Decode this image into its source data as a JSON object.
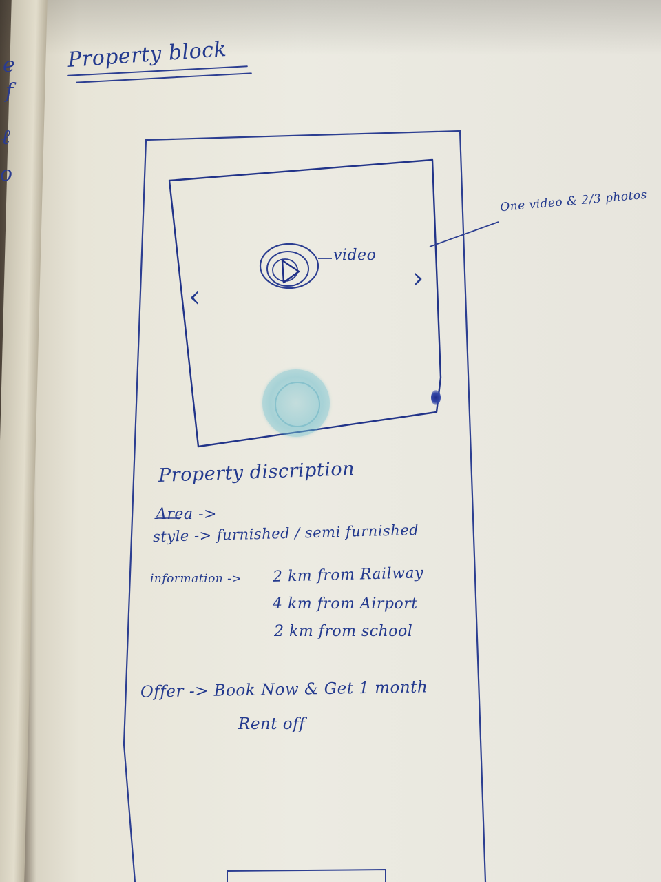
{
  "heading": "Property block",
  "annotation_right": "One video & 2/3 photos",
  "video_label": "video",
  "nav": {
    "prev_glyph": "‹",
    "next_glyph": "›"
  },
  "description_heading": "Property discription",
  "details": {
    "area_label": "Area ->",
    "style_line": "style -> furnished / semi furnished",
    "info_label": "information ->",
    "info_lines": [
      "2 km from Railway",
      "4 km from Airport",
      "2 km from school"
    ]
  },
  "offer": {
    "line1": "Offer -> Book Now & Get 1 month",
    "line2": "Rent off"
  },
  "colors": {
    "ink": "#243a8e",
    "paper": "#ecebe2",
    "stamp": "#6fbfd0"
  }
}
